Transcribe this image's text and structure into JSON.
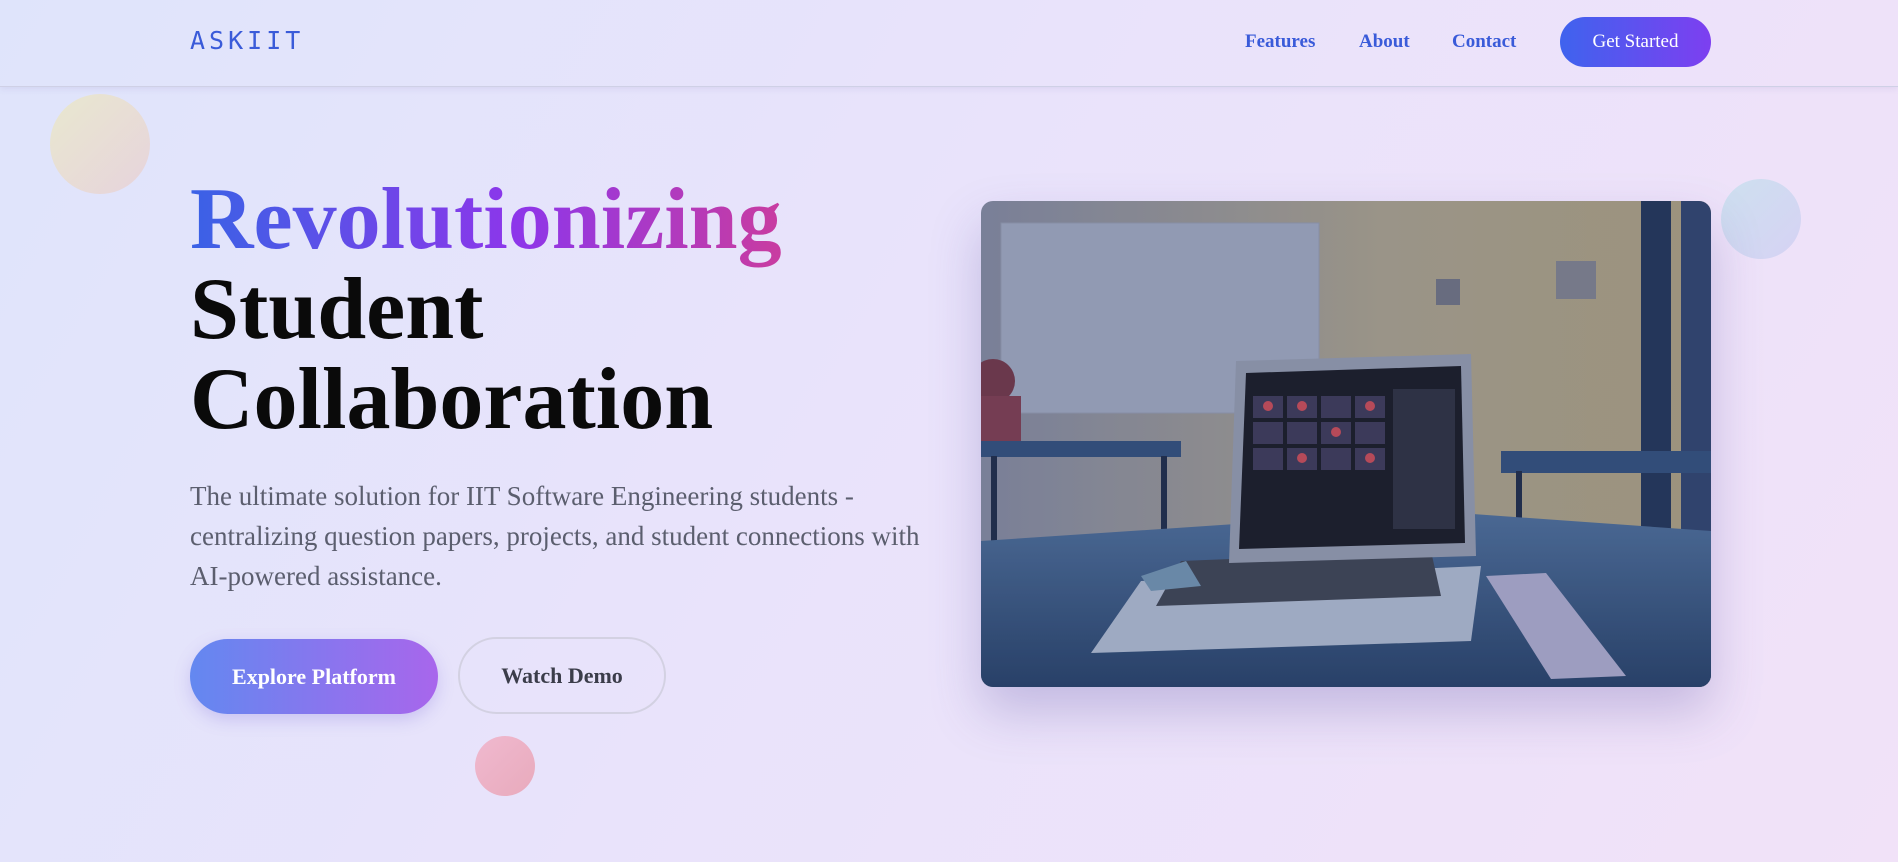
{
  "nav": {
    "logo": "ASKIIT",
    "links": [
      "Features",
      "About",
      "Contact"
    ],
    "cta": "Get Started"
  },
  "hero": {
    "title_highlight": "Revolutionizing",
    "title_line2": "Student",
    "title_line3": "Collaboration",
    "subtitle": "The ultimate solution for IIT Software Engineering students - centralizing question papers, projects, and student connections with AI-powered assistance.",
    "primary_button": "Explore Platform",
    "secondary_button": "Watch Demo"
  },
  "image": {
    "description_icon": "classroom-laptop-photo"
  },
  "colors": {
    "brand_blue": "#3a5bd9",
    "brand_purple": "#7d3ff0",
    "accent_pink": "#c93ca0"
  }
}
